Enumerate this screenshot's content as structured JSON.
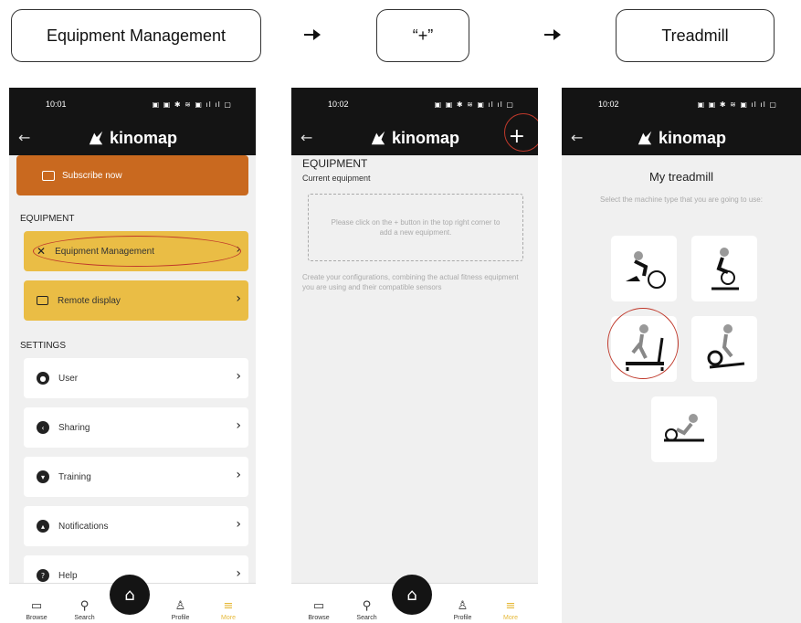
{
  "steps": {
    "step1": "Equipment Management",
    "step2": "“+”",
    "step3": "Treadmill"
  },
  "phone1": {
    "time": "10:01",
    "status_icons": "▣ ▣ ✱ ≋ ▣ ıl ıl ▢",
    "app_name": "kinomap",
    "subscribe": "Subscribe now",
    "sections": {
      "equipment": "EQUIPMENT",
      "settings": "SETTINGS"
    },
    "equipment_items": [
      "Equipment Management",
      "Remote display"
    ],
    "settings_items": [
      "User",
      "Sharing",
      "Training",
      "Notifications",
      "Help"
    ]
  },
  "phone2": {
    "time": "10:02",
    "status_icons": "▣ ▣ ✱ ≋ ▣ ıl ıl ▢",
    "app_name": "kinomap",
    "title": "EQUIPMENT",
    "subtitle": "Current equipment",
    "empty_hint": "Please click on the + button in the top right corner to add a new equipment.",
    "description": "Create your configurations, combining the actual fitness equipment you are using and their compatible sensors"
  },
  "phone3": {
    "time": "10:02",
    "status_icons": "▣ ▣ ✱ ≋ ▣ ıl ıl ▢",
    "app_name": "kinomap",
    "title": "My treadmill",
    "subtitle": "Select the machine type that you are going to use:"
  },
  "nav": {
    "browse": "Browse",
    "search": "Search",
    "profile": "Profile",
    "more": "More"
  },
  "colors": {
    "accent_yellow": "#eabd45",
    "subscribe_orange": "#c9691f",
    "bar_dark": "#141414",
    "highlight_red": "#c0392b"
  }
}
